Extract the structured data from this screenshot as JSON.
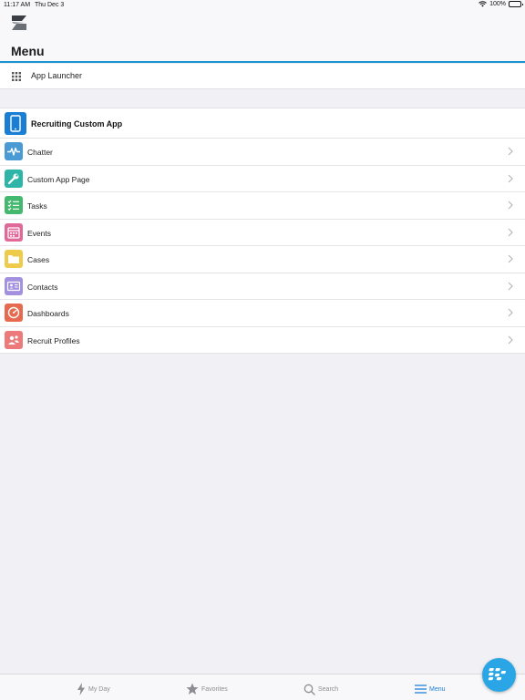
{
  "status_bar": {
    "time": "11:17 AM",
    "date": "Thu Dec 3",
    "battery": "100%"
  },
  "header": {
    "title": "Menu"
  },
  "launcher": {
    "label": "App Launcher"
  },
  "app": {
    "name": "Recruiting Custom App"
  },
  "items": [
    {
      "label": "Chatter",
      "icon": "chatter-pulse-icon",
      "color": "#4a9ad4"
    },
    {
      "label": "Custom App Page",
      "icon": "wrench-icon",
      "color": "#2fb5a8"
    },
    {
      "label": "Tasks",
      "icon": "checklist-icon",
      "color": "#44b86f"
    },
    {
      "label": "Events",
      "icon": "calendar-icon",
      "color": "#e0699a"
    },
    {
      "label": "Cases",
      "icon": "folder-icon",
      "color": "#efcb4b"
    },
    {
      "label": "Contacts",
      "icon": "contact-card-icon",
      "color": "#a391e0"
    },
    {
      "label": "Dashboards",
      "icon": "gauge-icon",
      "color": "#e56a4f"
    },
    {
      "label": "Recruit Profiles",
      "icon": "people-icon",
      "color": "#ec7a7a"
    }
  ],
  "tabs": [
    {
      "label": "My Day",
      "icon": "lightning-icon"
    },
    {
      "label": "Favorites",
      "icon": "star-icon"
    },
    {
      "label": "Search",
      "icon": "search-icon"
    },
    {
      "label": "Menu",
      "icon": "hamburger-icon"
    }
  ],
  "colors": {
    "accent": "#1a93d1",
    "active_tab": "#1a7fd4",
    "inactive_tab": "#8d8d93"
  }
}
